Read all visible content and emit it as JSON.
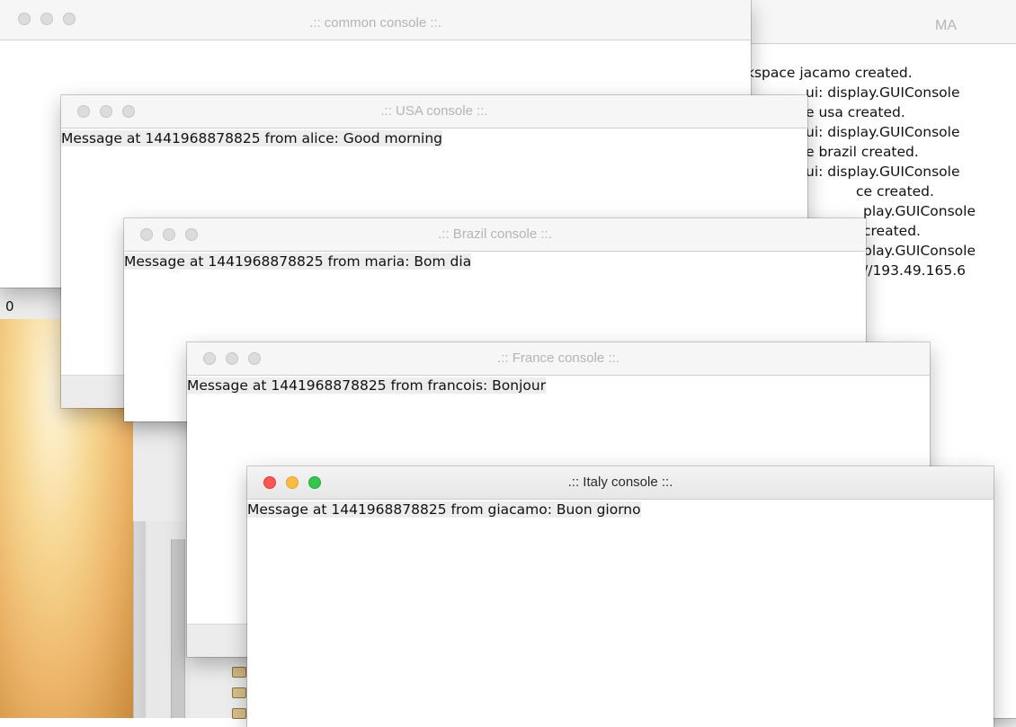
{
  "left_label": "0",
  "windows": {
    "mas": {
      "title": "MA",
      "lines": [
        "kspace jacamo created.",
        "ui: display.GUIConsole",
        "e usa created.",
        "ui: display.GUIConsole",
        "e brazil created.",
        "ui: display.GUIConsole",
        "ce created.",
        "play.GUIConsole",
        "created.",
        "play.GUIConsole",
        "//193.49.165.6"
      ]
    },
    "common": {
      "title": ".:: common console ::."
    },
    "usa": {
      "title": ".:: USA console ::.",
      "message": "Message at 1441968878825 from alice: Good morning"
    },
    "brazil": {
      "title": ".:: Brazil console ::.",
      "message": "Message at 1441968878825 from maria: Bom dia"
    },
    "france": {
      "title": ".:: France console ::.",
      "message": "Message at 1441968878825 from francois: Bonjour"
    },
    "italy": {
      "title": ".:: Italy console ::.",
      "message": "Message at 1441968878825 from giacamo: Buon giorno"
    }
  },
  "colors": {
    "close": "#fc5753",
    "minimize": "#fdbc40",
    "zoom": "#34c84a"
  }
}
